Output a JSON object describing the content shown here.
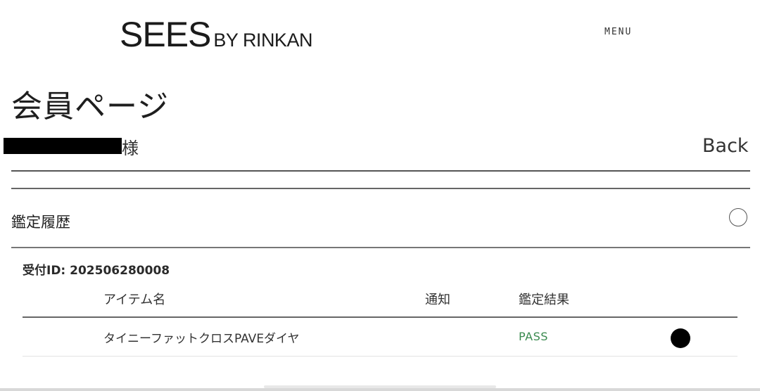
{
  "header": {
    "logo_main": "SEES",
    "logo_sub": "BY RINKAN",
    "menu_label": "MENU"
  },
  "page": {
    "title": "会員ページ",
    "user_suffix": "様",
    "back_label": "Back"
  },
  "history": {
    "section_title": "鑑定履歴",
    "receipt_label": "受付ID: 202506280008",
    "columns": {
      "item_name": "アイテム名",
      "notification": "通知",
      "result": "鑑定結果"
    },
    "rows": [
      {
        "item_name": "タイニーファットクロスPAVEダイヤ",
        "notification": "",
        "result": "PASS"
      }
    ]
  },
  "colors": {
    "pass_status": "#3a8a4f",
    "text": "#222222",
    "redaction": "#000000"
  },
  "icons": {
    "section_toggle": "circle-outline-icon",
    "row_indicator": "filled-circle-icon"
  }
}
